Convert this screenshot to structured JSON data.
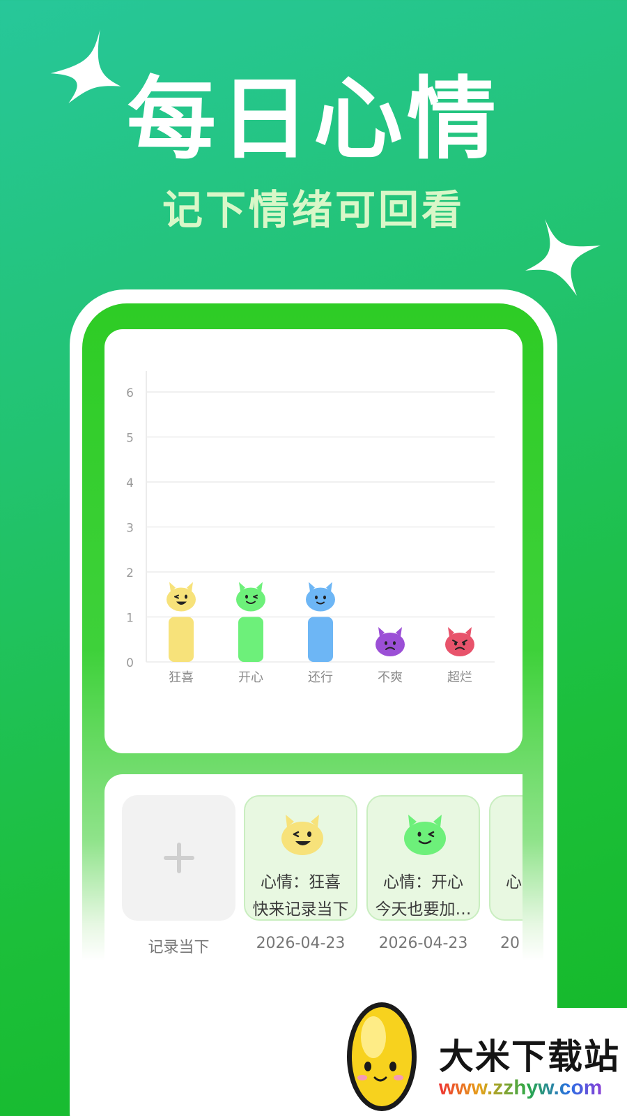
{
  "hero": {
    "title": "每日心情",
    "subtitle": "记下情绪可回看"
  },
  "chart_data": {
    "type": "bar",
    "categories": [
      "狂喜",
      "开心",
      "还行",
      "不爽",
      "超烂"
    ],
    "values": [
      1,
      1,
      1,
      0,
      0
    ],
    "bar_colors": [
      "#f7e27a",
      "#6df07a",
      "#6db6f5",
      "#9b4fd6",
      "#e8536b"
    ],
    "face_colors": [
      "#f7e27a",
      "#6df07a",
      "#6db6f5",
      "#9b4fd6",
      "#e8536b"
    ],
    "face_icons": [
      "laughing-wink-face-icon",
      "wink-face-icon",
      "smile-face-icon",
      "frown-face-icon",
      "angry-face-icon"
    ],
    "ylim": [
      0,
      6
    ],
    "yticks": [
      "0",
      "1",
      "2",
      "3",
      "4",
      "5",
      "6"
    ],
    "grid": true
  },
  "entries": [
    {
      "type": "add",
      "icon": "plus-icon",
      "date_label": "记录当下"
    },
    {
      "type": "mood",
      "icon": "laughing-wink-face-icon",
      "color": "#f7e27a",
      "mood": "心情：狂喜",
      "note": "快来记录当下",
      "date": "2026-04-23"
    },
    {
      "type": "mood",
      "icon": "wink-face-icon",
      "color": "#6df07a",
      "mood": "心情：开心",
      "note": "今天也要加…",
      "date": "2026-04-23"
    },
    {
      "type": "mood",
      "icon": "",
      "color": "#6df07a",
      "mood": "心",
      "note": "",
      "date": "20"
    }
  ],
  "watermark": {
    "name": "大米下载站",
    "url": "www.zzhyw.com"
  }
}
